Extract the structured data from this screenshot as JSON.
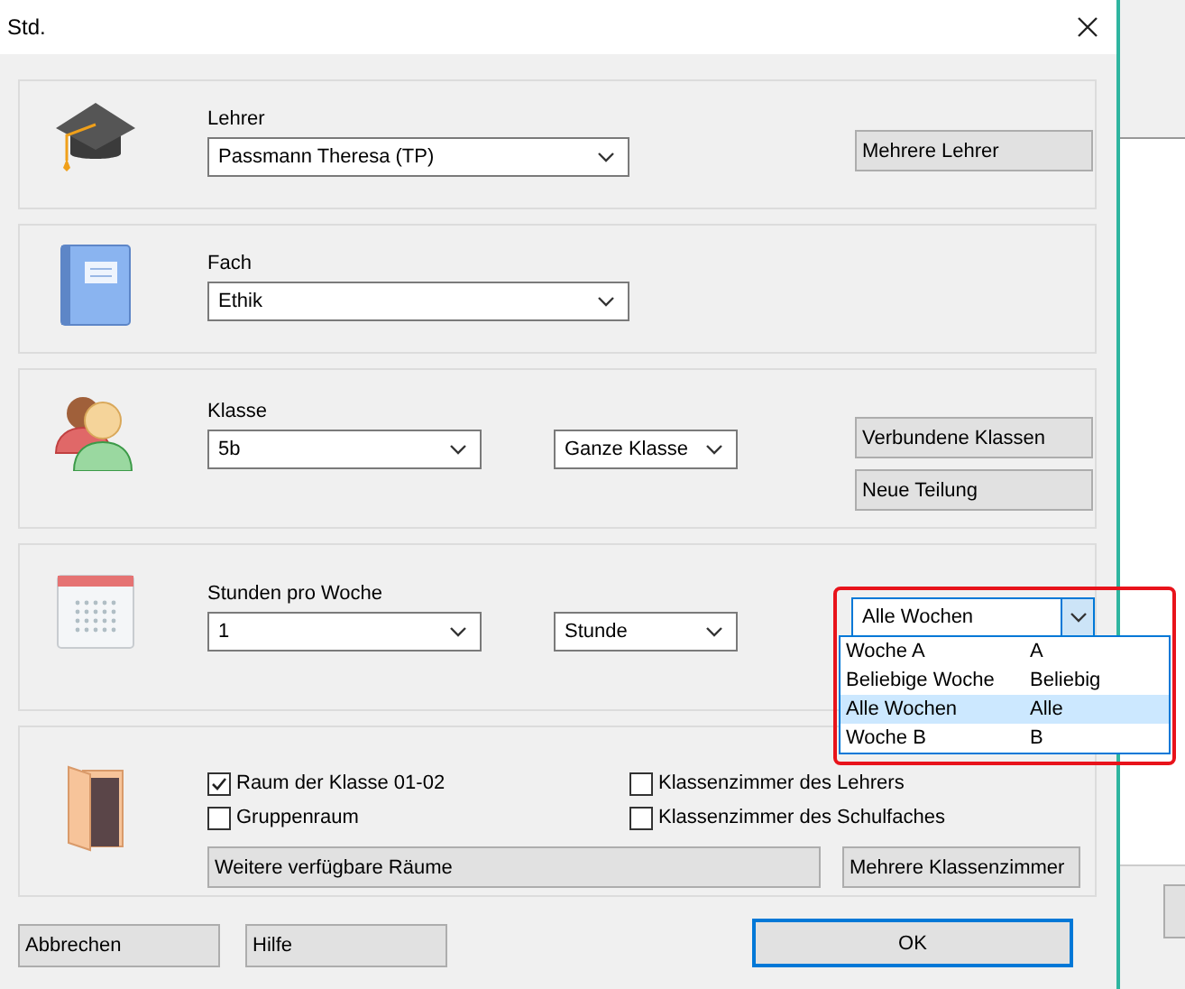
{
  "window": {
    "title": "Std."
  },
  "sections": [
    {
      "kind": "teacher",
      "label": "Lehrer",
      "combos": [
        {
          "value": "Passmann Theresa (TP)"
        }
      ],
      "buttons": [
        "Mehrere Lehrer"
      ]
    },
    {
      "kind": "subject",
      "label": "Fach",
      "combos": [
        {
          "value": "Ethik"
        }
      ]
    },
    {
      "kind": "class",
      "label": "Klasse",
      "combos": [
        {
          "value": "5b"
        },
        {
          "value": "Ganze Klasse"
        }
      ],
      "buttons": [
        "Verbundene Klassen",
        "Neue Teilung"
      ]
    },
    {
      "kind": "hours",
      "label": "Stunden pro Woche",
      "combos": [
        {
          "value": "1"
        },
        {
          "value": "Stunde"
        }
      ],
      "week_select": {
        "value": "Alle Wochen",
        "expanded": true,
        "options": [
          {
            "label": "Woche A",
            "code": "A",
            "selected": false
          },
          {
            "label": "Beliebige Woche",
            "code": "Beliebig",
            "selected": false
          },
          {
            "label": "Alle Wochen",
            "code": "Alle",
            "selected": true
          },
          {
            "label": "Woche B",
            "code": "B",
            "selected": false
          }
        ]
      }
    },
    {
      "kind": "rooms",
      "checkboxes": [
        {
          "label": "Raum der Klasse 01-02",
          "checked": true
        },
        {
          "label": "Klassenzimmer des Lehrers",
          "checked": false
        },
        {
          "label": "Gruppenraum",
          "checked": false
        },
        {
          "label": "Klassenzimmer des Schulfaches",
          "checked": false
        }
      ],
      "wide_button": "Weitere verfügbare Räume",
      "buttons": [
        "Mehrere Klassenzimmer"
      ]
    }
  ],
  "footer": [
    {
      "label": "Abbrechen",
      "default": false
    },
    {
      "label": "Hilfe",
      "default": false
    },
    {
      "label": "OK",
      "default": true
    }
  ]
}
